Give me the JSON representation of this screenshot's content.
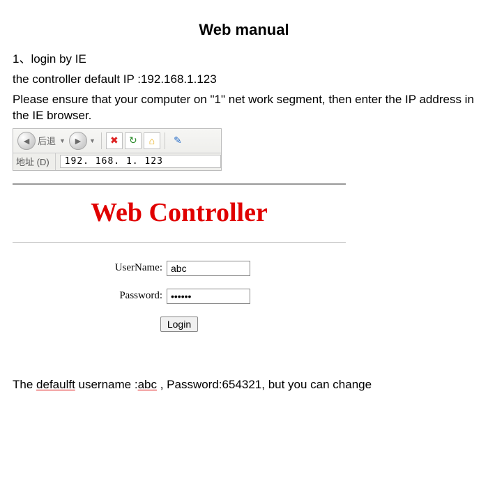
{
  "title": "Web manual",
  "intro": {
    "line1": "1、login by IE",
    "line2": "the controller default IP :192.168.1.123",
    "line3": "Please ensure that your computer on \"1\" net work segment, then enter the IP address in the IE browser."
  },
  "ie": {
    "back_label": "后退",
    "address_label": "地址 (D)",
    "address_value": "192. 168. 1. 123"
  },
  "login": {
    "heading": "Web Controller",
    "username_label": "UserName:",
    "username_value": "abc",
    "password_label": "Password:",
    "password_masked": "••••••",
    "login_button": "Login"
  },
  "footer": {
    "prefix": "The ",
    "word_defaulft": "defaulft",
    "mid1": " username :",
    "word_abc": "abc",
    "mid2": " , Password:654321, but you can change"
  }
}
